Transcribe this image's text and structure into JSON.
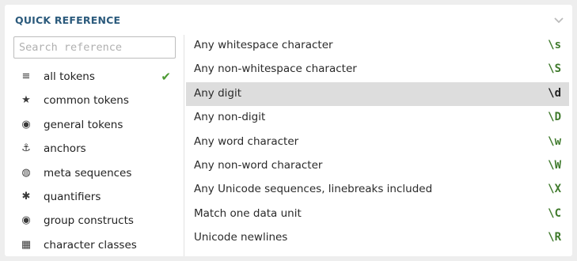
{
  "panel": {
    "title": "QUICK REFERENCE",
    "collapse_icon": "chevron-down-icon"
  },
  "search": {
    "placeholder": "Search reference",
    "value": ""
  },
  "categories": [
    {
      "label": "all tokens",
      "icon": "database-icon",
      "glyph": "≡",
      "active": true
    },
    {
      "label": "common tokens",
      "icon": "star-icon",
      "glyph": "★",
      "active": false
    },
    {
      "label": "general tokens",
      "icon": "target-icon",
      "glyph": "◉",
      "active": false
    },
    {
      "label": "anchors",
      "icon": "anchor-icon",
      "glyph": "⚓",
      "active": false
    },
    {
      "label": "meta sequences",
      "icon": "globe-icon",
      "glyph": "◍",
      "active": false
    },
    {
      "label": "quantifiers",
      "icon": "asterisk-icon",
      "glyph": "✱",
      "active": false
    },
    {
      "label": "group constructs",
      "icon": "target-icon",
      "glyph": "◉",
      "active": false
    },
    {
      "label": "character classes",
      "icon": "grid-icon",
      "glyph": "▦",
      "active": false
    }
  ],
  "active_check_icon": "checkmark-icon",
  "tokens": [
    {
      "description": "Any whitespace character",
      "token": "\\s",
      "selected": false
    },
    {
      "description": "Any non-whitespace character",
      "token": "\\S",
      "selected": false
    },
    {
      "description": "Any digit",
      "token": "\\d",
      "selected": true
    },
    {
      "description": "Any non-digit",
      "token": "\\D",
      "selected": false
    },
    {
      "description": "Any word character",
      "token": "\\w",
      "selected": false
    },
    {
      "description": "Any non-word character",
      "token": "\\W",
      "selected": false
    },
    {
      "description": "Any Unicode sequences, linebreaks included",
      "token": "\\X",
      "selected": false
    },
    {
      "description": "Match one data unit",
      "token": "\\C",
      "selected": false
    },
    {
      "description": "Unicode newlines",
      "token": "\\R",
      "selected": false
    }
  ],
  "colors": {
    "title": "#2b5a7c",
    "token": "#3f7a2c",
    "check": "#4c9a33",
    "selected_row": "#dddddd"
  }
}
